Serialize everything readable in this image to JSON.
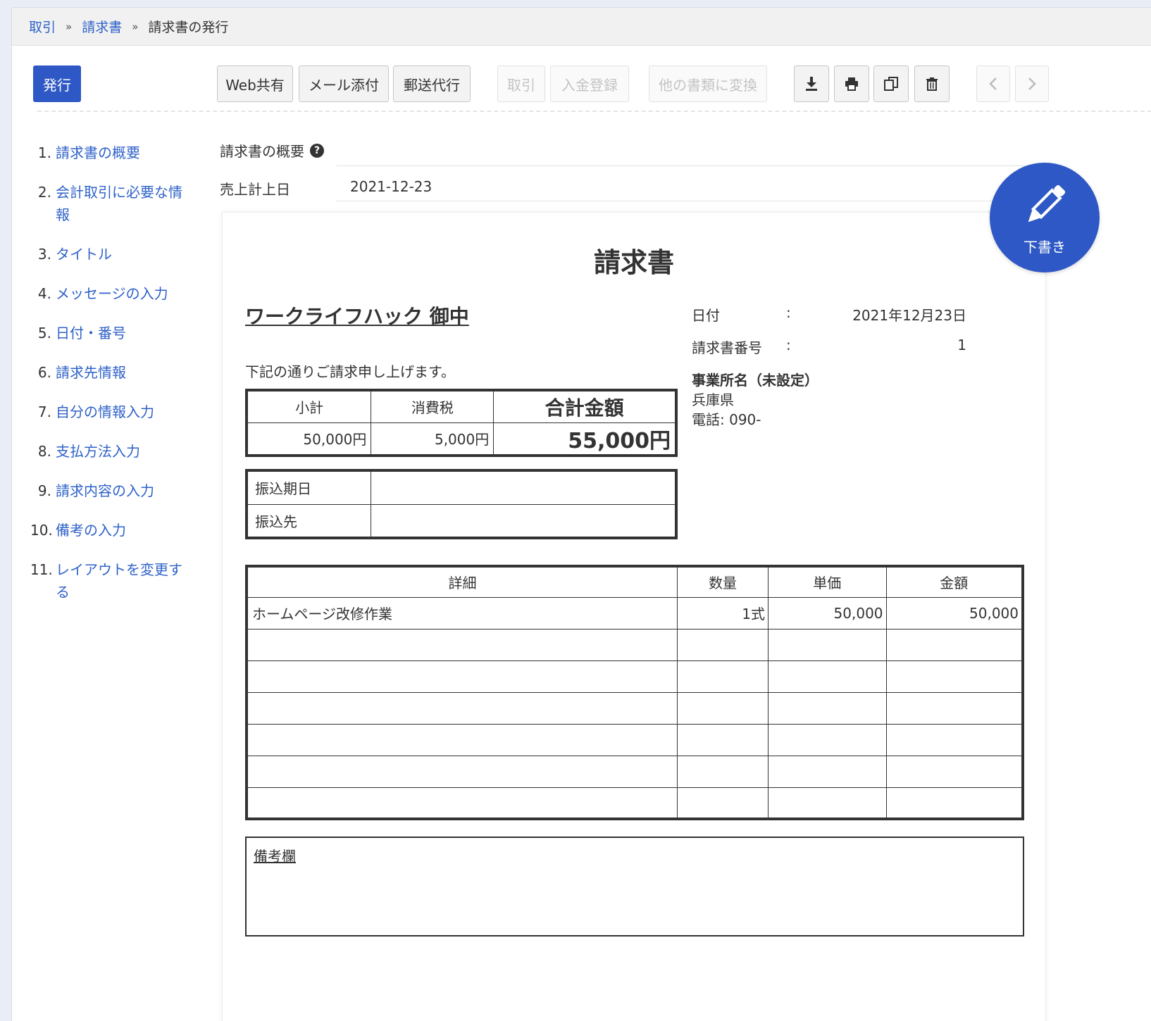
{
  "breadcrumb": {
    "items": [
      "取引",
      "請求書"
    ],
    "current": "請求書の発行",
    "separator": "»"
  },
  "toolbar": {
    "issue": "発行",
    "web_share": "Web共有",
    "mail_attach": "メール添付",
    "postal": "郵送代行",
    "deal": "取引",
    "payment_register": "入金登録",
    "convert": "他の書類に変換"
  },
  "nav": {
    "items": [
      {
        "num": "1.",
        "label": "請求書の概要"
      },
      {
        "num": "2.",
        "label": "会計取引に必要な情報"
      },
      {
        "num": "3.",
        "label": "タイトル"
      },
      {
        "num": "4.",
        "label": "メッセージの入力"
      },
      {
        "num": "5.",
        "label": "日付・番号"
      },
      {
        "num": "6.",
        "label": "請求先情報"
      },
      {
        "num": "7.",
        "label": "自分の情報入力"
      },
      {
        "num": "8.",
        "label": "支払方法入力"
      },
      {
        "num": "9.",
        "label": "請求内容の入力"
      },
      {
        "num": "10.",
        "label": "備考の入力"
      },
      {
        "num": "11.",
        "label": "レイアウトを変更する"
      }
    ]
  },
  "summary": {
    "title": "請求書の概要",
    "sales_date_label": "売上計上日",
    "sales_date": "2021-12-23"
  },
  "draft_button": {
    "label": "下書き"
  },
  "invoice": {
    "title": "請求書",
    "client": "ワークライフハック 御中",
    "intro": "下記の通りご請求申し上げます。",
    "date_label": "日付",
    "date": "2021年12月23日",
    "number_label": "請求書番号",
    "number": "1",
    "colon": ":",
    "issuer_name": "事業所名（未設定）",
    "issuer_pref": "兵庫県",
    "issuer_tel": "電話: 090-",
    "totals": {
      "subtotal_label": "小計",
      "tax_label": "消費税",
      "total_label": "合計金額",
      "subtotal": "50,000円",
      "tax": "5,000円",
      "total": "55,000円"
    },
    "bank": {
      "due_label": "振込期日",
      "account_label": "振込先"
    },
    "items_header": {
      "detail": "詳細",
      "qty": "数量",
      "unit_price": "単価",
      "amount": "金額"
    },
    "items": [
      {
        "detail": "ホームページ改修作業",
        "qty": "1式",
        "unit_price": "50,000",
        "amount": "50,000"
      }
    ],
    "remarks_label": "備考欄"
  }
}
